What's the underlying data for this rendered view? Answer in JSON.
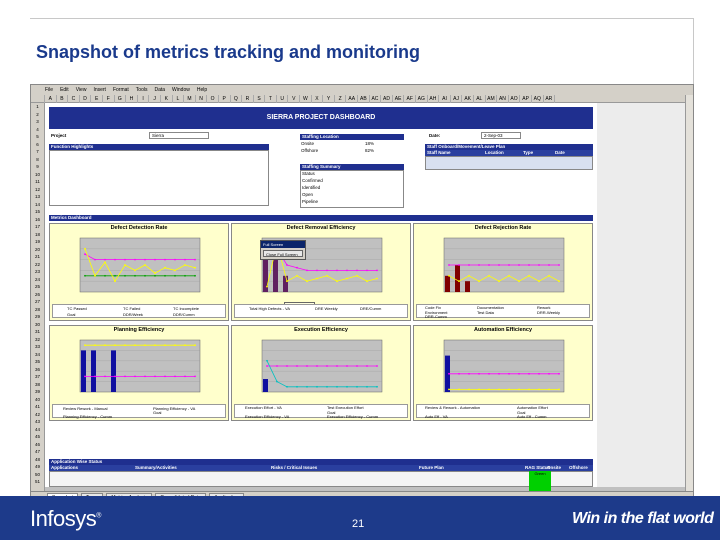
{
  "slide": {
    "title": "Snapshot of metrics tracking and monitoring",
    "page_number": "21",
    "logo": "Infosys",
    "tagline": "Win in the flat world"
  },
  "excel": {
    "menu": [
      "File",
      "Edit",
      "View",
      "Insert",
      "Format",
      "Tools",
      "Data",
      "Window",
      "Help"
    ],
    "columns": [
      "A",
      "B",
      "C",
      "D",
      "E",
      "F",
      "G",
      "H",
      "I",
      "J",
      "K",
      "L",
      "M",
      "N",
      "O",
      "P",
      "Q",
      "R",
      "S",
      "T",
      "U",
      "V",
      "W",
      "X",
      "Y",
      "Z",
      "AA",
      "AB",
      "AC",
      "AD",
      "AE",
      "AF",
      "AG",
      "AH",
      "AI",
      "AJ",
      "AK",
      "AL",
      "AM",
      "AN",
      "AO",
      "AP",
      "AQ",
      "AR"
    ],
    "sheet_tabs": [
      "Snapshot",
      "Team",
      "Metrics Analysis",
      "Consolidated Data",
      "Application"
    ]
  },
  "dashboard": {
    "title": "SIERRA PROJECT DASHBOARD",
    "project_label": "Project",
    "project_value": "Sierra",
    "date_label": "Date:",
    "date_value": "2-Sep-03",
    "function_highlights": "Function Highlights",
    "staffing_location": {
      "header": "Staffing Location",
      "rows": [
        {
          "label": "Onsite",
          "value": "18%"
        },
        {
          "label": "Offshore",
          "value": "82%"
        }
      ]
    },
    "staffing_summary": {
      "header": "Staffing Summary",
      "rows": [
        "Status",
        "Confirmed",
        "Identified",
        "Open",
        "Pipeline"
      ]
    },
    "staff_plan": {
      "header": "Staff Onboard/Movement/Leave Plan",
      "cols": [
        "Staff Name",
        "Location",
        "Type",
        "Date"
      ]
    },
    "metrics_dashboard": "Metrics Dashboard",
    "popup": {
      "title": "Full Screen",
      "button": "Close Full Screen"
    },
    "charts": {
      "defect_detection": {
        "title": "Defect Detection Rate",
        "legend": [
          "TC Passed",
          "TC Failed",
          "TC Incomplete",
          "Goal",
          "DDR/Week",
          "DDR/Cumm"
        ]
      },
      "defect_removal": {
        "title": "Defect Removal Efficiency",
        "legend": [
          "Total High Defects - VA",
          "DRE Weekly",
          "DRE/Cumm"
        ],
        "tooltip": "Category Axis"
      },
      "defect_rejection": {
        "title": "Defect Rejection Rate",
        "legend": [
          "Code Fix",
          "Documentation",
          "Rework",
          "Environment",
          "Test Data",
          "DRR-Weekly",
          "DRR-Cumm"
        ]
      },
      "planning": {
        "title": "Planning Efficiency",
        "legend": [
          "Review Rework - Manual",
          "Planning Efficiency - VA",
          "Goal",
          "Planning Efficiency - Cumm"
        ]
      },
      "execution": {
        "title": "Execution Efficiency",
        "legend": [
          "Execution Effort - VA",
          "Test Execution Effort",
          "Goal",
          "Execution Efficiency - VA",
          "Execution Efficiency - Cumm"
        ]
      },
      "automation": {
        "title": "Automation Efficiency",
        "legend": [
          "Review & Rework - Automation",
          "Automation Effort",
          "Goal",
          "Auto Eff - VA",
          "Auto Eff - Cumm"
        ]
      }
    },
    "app_status": {
      "header": "Application Wise Status",
      "cols": [
        "Applications",
        "Summary/Activities",
        "Risks / Critical Issues",
        "Future Plan",
        "RAG Status",
        "Onsite",
        "Offshore"
      ],
      "rag": "Green"
    }
  }
}
